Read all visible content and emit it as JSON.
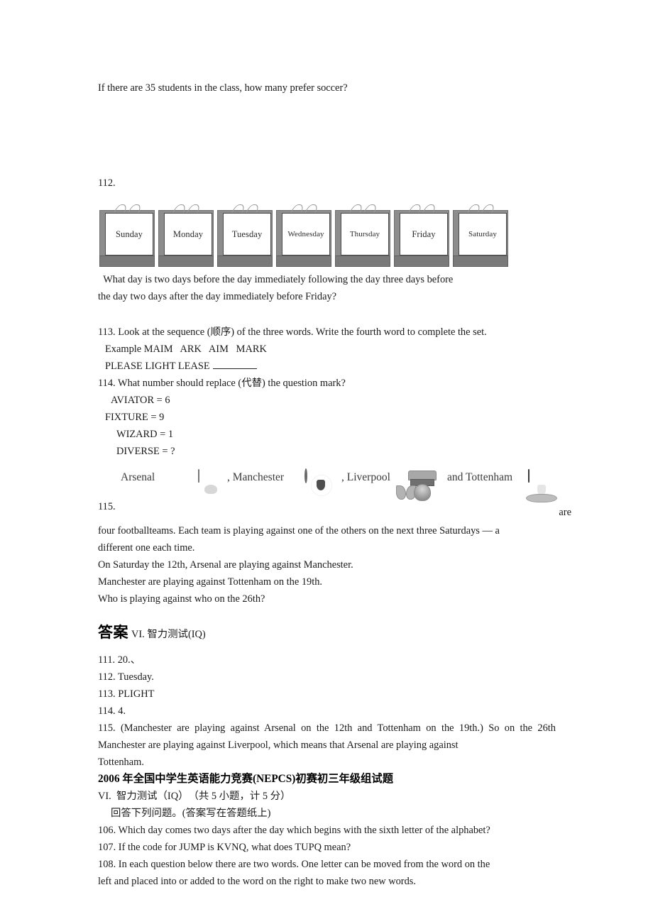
{
  "document": {
    "intro_question": "If there are 35 students in the class, how many prefer soccer?"
  },
  "question_112": {
    "number": "112.",
    "calendar_days": [
      "Sunday",
      "Monday",
      "Tuesday",
      "Wednesday",
      "Thursday",
      "Friday",
      "Saturday"
    ],
    "prompt_line1": "  What day is two days before the day immediately following the day three days before",
    "prompt_line2": "the day two days after the day immediately before Friday?"
  },
  "question_113": {
    "stem": "113. Look at the sequence (顺序) of the three words. Write the fourth word to complete the set.",
    "example": "Example MAIM   ARK   AIM   MARK",
    "task": "PLEASE LIGHT LEASE"
  },
  "question_114": {
    "stem": "114. What number should replace (代替) the question mark?",
    "items": [
      "AVIATOR = 6",
      "FIXTURE = 9",
      "WIZARD = 1",
      "DIVERSE = ?"
    ]
  },
  "question_115": {
    "number": "115.",
    "teams": [
      {
        "name": "Arsenal",
        "crest": "arsenal-crest-icon"
      },
      {
        "name": ", Manchester",
        "crest": "manchester-united-crest-icon"
      },
      {
        "name": ", Liverpool",
        "crest": "liverpool-crest-icon"
      },
      {
        "name": "and Tottenham",
        "crest": "tottenham-hotspur-crest-icon"
      }
    ],
    "trailing_word": "are",
    "body_line1": "four footballteams. Each team is playing against one of the others on the next three Saturdays — a",
    "body_line2": "different one each time.",
    "body_line3": "On Saturday the 12th, Arsenal are playing against Manchester.",
    "body_line4": "Manchester are playing against Tottenham on the 19th.",
    "body_line5": "Who is playing against who on the 26th?"
  },
  "answers_section": {
    "heading_cn": "答案",
    "heading_rest": "VI.  智力测试(IQ)",
    "items": [
      "111. 20.、",
      "112. Tuesday.",
      "113. PLIGHT",
      "114. 4."
    ],
    "answer_115_p1": "115. (Manchester are playing against Arsenal on the 12th and Tottenham on the 19th.) So on the 26th Manchester are playing against Liverpool, which means that Arsenal are playing against",
    "answer_115_p2": "Tottenham."
  },
  "next_exam": {
    "title": "2006 年全国中学生英语能力竞赛(NEPCS)初赛初三年级组试题",
    "section_line": "VI.  智力测试（IQ）　（共 5 小题，计 5 分）",
    "instruction": "回答下列问题。(答案写在答题纸上)",
    "questions": [
      "106. Which day comes two days after the day which begins with the sixth letter of the alphabet?",
      "107. If the code for JUMP is KVNQ, what does TUPQ mean?"
    ],
    "question_108_line1": "108. In each question below there are two words. One letter can be moved from the word on the",
    "question_108_line2": "left and placed into or added to the word on the right to make two new words."
  }
}
